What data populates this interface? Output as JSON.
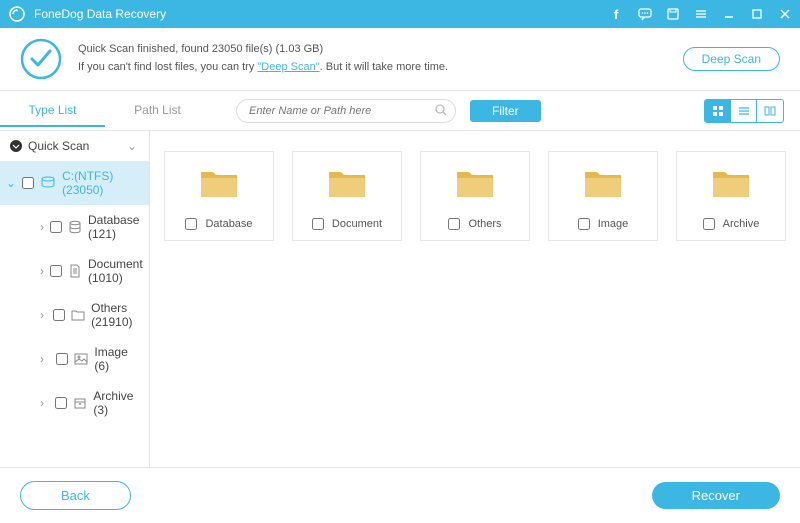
{
  "app": {
    "title": "FoneDog Data Recovery"
  },
  "status": {
    "line1": "Quick Scan finished, found 23050 file(s) (1.03 GB)",
    "line2a": "If you can't find lost files, you can try ",
    "deep_link": "\"Deep Scan\"",
    "line2b": ". But it will take more time.",
    "deep_scan_btn": "Deep Scan"
  },
  "tabs": {
    "type_list": "Type List",
    "path_list": "Path List"
  },
  "search": {
    "placeholder": "Enter Name or Path here"
  },
  "filter_btn": "Filter",
  "tree": {
    "root": "Quick Scan",
    "drive": "C:(NTFS) (23050)",
    "items": [
      {
        "label": "Database (121)"
      },
      {
        "label": "Document (1010)"
      },
      {
        "label": "Others (21910)"
      },
      {
        "label": "Image (6)"
      },
      {
        "label": "Archive (3)"
      }
    ]
  },
  "folders": [
    {
      "label": "Database"
    },
    {
      "label": "Document"
    },
    {
      "label": "Others"
    },
    {
      "label": "Image"
    },
    {
      "label": "Archive"
    }
  ],
  "footer": {
    "back": "Back",
    "recover": "Recover"
  },
  "colors": {
    "accent": "#3cb6e3"
  }
}
